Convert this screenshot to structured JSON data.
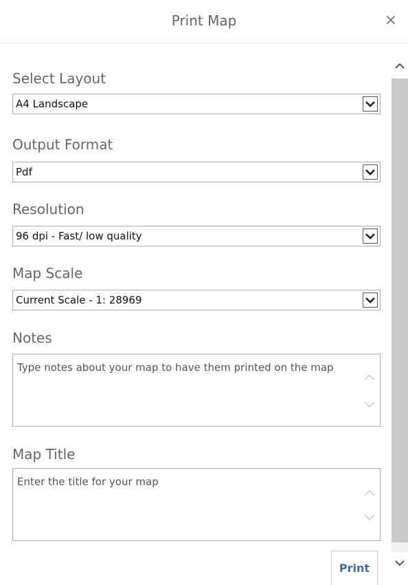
{
  "dialog": {
    "title": "Print Map",
    "close_glyph": "×"
  },
  "fields": {
    "layout": {
      "label": "Select Layout",
      "value": "A4 Landscape"
    },
    "format": {
      "label": "Output Format",
      "value": "Pdf"
    },
    "resolution": {
      "label": "Resolution",
      "value": "96 dpi - Fast/ low quality"
    },
    "scale": {
      "label": "Map Scale",
      "value": "Current Scale - 1: 28969"
    },
    "notes": {
      "label": "Notes",
      "placeholder": "Type notes about your map to have them printed on the map"
    },
    "map_title": {
      "label": "Map Title",
      "placeholder": "Enter the title for your map"
    }
  },
  "actions": {
    "print_label": "Print"
  },
  "icons": {
    "dropdown": "chevron-down-icon",
    "scroll_up": "chevron-up-icon",
    "scroll_down": "chevron-down-icon",
    "close": "close-icon"
  },
  "colors": {
    "print_text": "#3a6ea5",
    "scroll_thumb": "#c9c9c9"
  }
}
